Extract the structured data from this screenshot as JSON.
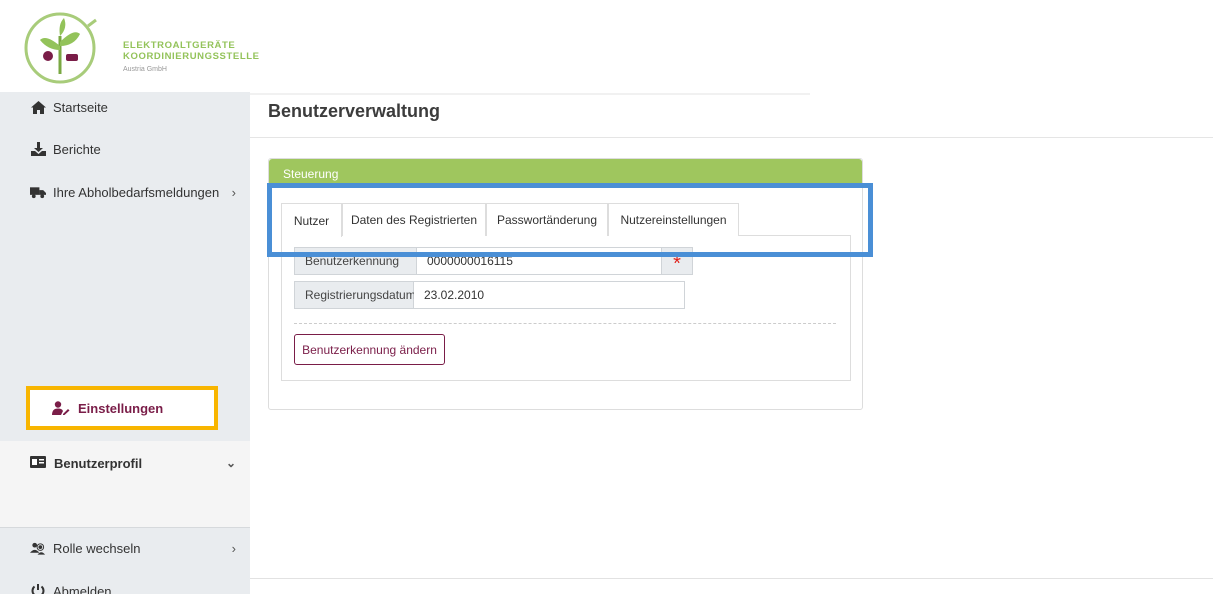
{
  "brand": {
    "line1": "ELEKTROALTGERÄTE",
    "line2": "KOORDINIERUNGSSTELLE",
    "line3": "Austria GmbH",
    "primary_color": "#93c35a",
    "accent_color": "#7a1d48"
  },
  "sidebar": {
    "items": [
      {
        "label": "Startseite",
        "icon": "home-icon"
      },
      {
        "label": "Berichte",
        "icon": "download-box-icon"
      },
      {
        "label": "Ihre Abholbedarfsmeldungen",
        "icon": "truck-icon",
        "has_submenu": true
      }
    ],
    "profile": {
      "label": "Benutzerprofil",
      "icon": "id-card-icon",
      "expanded": true
    },
    "settings": {
      "label": "Einstellungen",
      "icon": "user-edit-icon"
    },
    "role": {
      "label": "Rolle wechseln",
      "icon": "users-icon",
      "has_submenu": true
    },
    "logout": {
      "label": "Abmelden",
      "icon": "power-icon"
    }
  },
  "main": {
    "title": "Benutzerverwaltung",
    "panel": {
      "header": "Steuerung",
      "tabs": [
        {
          "label": "Nutzer",
          "active": true
        },
        {
          "label": "Daten des Registrierten",
          "active": false
        },
        {
          "label": "Passwortänderung",
          "active": false
        },
        {
          "label": "Nutzereinstellungen",
          "active": false
        }
      ],
      "fields": {
        "user_id": {
          "label": "Benutzerkennung",
          "value": "0000000016115",
          "required_marker": "*"
        },
        "reg_date": {
          "label": "Registrierungsdatum",
          "value": "23.02.2010"
        }
      },
      "change_button": "Benutzerkennung ändern"
    }
  },
  "highlights": {
    "tabs_color": "#4a8fd6",
    "settings_color": "#f8b500"
  }
}
